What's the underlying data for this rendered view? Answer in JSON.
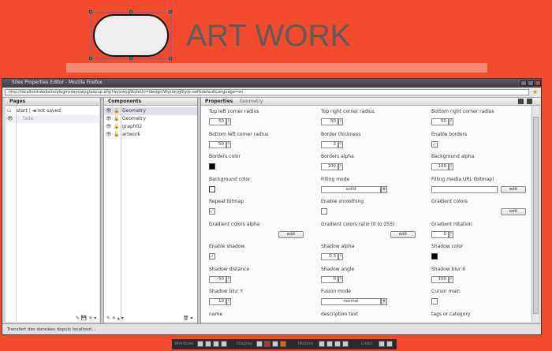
{
  "stage": {
    "title": "ART WORK"
  },
  "window": {
    "title": "Silex Properties Editor - Mozilla Firefox",
    "url": "http://localhost/website/plugins/wysiwyg/popup.php?wysiwygStyleUrl=design/WysiwygStyle.swf&defaultLanguage=en",
    "status": "Transfert des données depuis localhost..."
  },
  "pages": {
    "header": "Pages",
    "items": [
      {
        "label": "start | ◄ not saved",
        "icon": "page-icon"
      },
      {
        "label": "fade",
        "icon": "eye-icon"
      }
    ]
  },
  "components": {
    "header": "Components",
    "items": [
      "Geometry",
      "Geometry",
      "graph02",
      "artwork"
    ]
  },
  "properties": {
    "header": "Properties",
    "subheader": "Geometry",
    "fields": [
      {
        "label": "Top left corner radius",
        "kind": "number",
        "value": "50"
      },
      {
        "label": "Top right corner radius",
        "kind": "number",
        "value": "50"
      },
      {
        "label": "Bottom right corner radius",
        "kind": "number",
        "value": "50"
      },
      {
        "label": "Bottom left corner radius",
        "kind": "number",
        "value": "50"
      },
      {
        "label": "Border thickness",
        "kind": "number",
        "value": "3"
      },
      {
        "label": "Enable borders",
        "kind": "check",
        "checked": true
      },
      {
        "label": "Borders color",
        "kind": "color",
        "color": "#000000"
      },
      {
        "label": "Borders alpha",
        "kind": "number",
        "value": "100"
      },
      {
        "label": "Background alpha",
        "kind": "number",
        "value": "100"
      },
      {
        "label": "Background color",
        "kind": "color",
        "color": "#ffffff"
      },
      {
        "label": "Filling mode",
        "kind": "select",
        "value": "solid"
      },
      {
        "label": "Filling media URL (bitmap)",
        "kind": "textbtn",
        "button": "edit"
      },
      {
        "label": "Repeat bitmap",
        "kind": "check",
        "checked": true
      },
      {
        "label": "Enable smoothing",
        "kind": "check",
        "checked": false
      },
      {
        "label": "Gradient colors",
        "kind": "btn",
        "button": "edit"
      },
      {
        "label": "Gradient colors alpha",
        "kind": "btn",
        "button": "edit"
      },
      {
        "label": "Gradient colors ratio (0 to 255)",
        "kind": "btn",
        "button": "edit"
      },
      {
        "label": "Gradient rotation",
        "kind": "number",
        "value": "0"
      },
      {
        "label": "Enable shadow",
        "kind": "check",
        "checked": true
      },
      {
        "label": "Shadow alpha",
        "kind": "number",
        "value": "0.3"
      },
      {
        "label": "Shadow color",
        "kind": "color",
        "color": "#000000"
      },
      {
        "label": "Shadow distance",
        "kind": "number",
        "value": "-50"
      },
      {
        "label": "Shadow angle",
        "kind": "number",
        "value": "0"
      },
      {
        "label": "Shadow blur X",
        "kind": "number",
        "value": "100"
      },
      {
        "label": "Shadow blur Y",
        "kind": "number",
        "value": "10"
      },
      {
        "label": "Fusion mode",
        "kind": "select",
        "value": "normal"
      },
      {
        "label": "Cursor main",
        "kind": "check",
        "checked": false
      },
      {
        "label": "name",
        "kind": "none"
      },
      {
        "label": "description text",
        "kind": "none"
      },
      {
        "label": "tags or category",
        "kind": "none"
      }
    ]
  },
  "bottom_toolbar": {
    "labels": [
      "Windows",
      "Display",
      "History",
      "Links"
    ]
  }
}
